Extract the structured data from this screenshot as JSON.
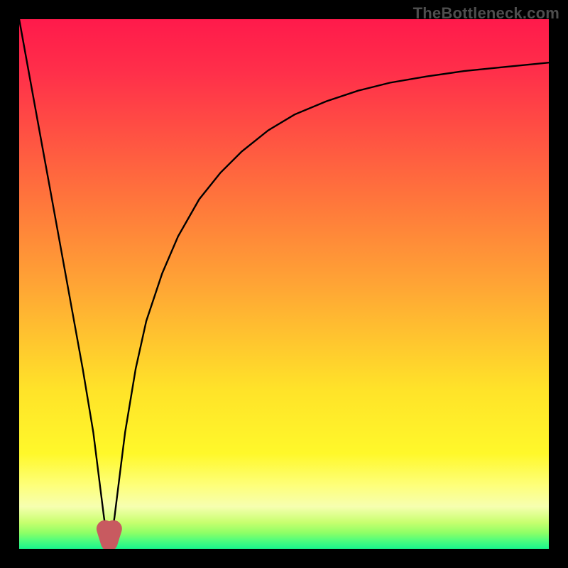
{
  "watermark": "TheBottleneck.com",
  "gradient_colors": {
    "top": "#ff1a4b",
    "red": "#ff2f4a",
    "orange1": "#ff783b",
    "orange2": "#ffa435",
    "yellow": "#ffe329",
    "yellow2": "#fff82a",
    "lightyellow": "#feff7a",
    "paleyellow": "#f6ffb0",
    "lime": "#c8ff6f",
    "green1": "#8eff66",
    "green2": "#4dfd7e",
    "green3": "#19f68c"
  },
  "curve_style": {
    "stroke": "#000000",
    "stroke_width": 2.4
  },
  "marker_style": {
    "fill": "#c85a60",
    "stroke": "#c85a60",
    "stroke_width": 24,
    "radius": 12
  },
  "chart_data": {
    "type": "line",
    "title": "",
    "xlabel": "",
    "ylabel": "",
    "xlim": [
      0,
      100
    ],
    "ylim": [
      0,
      100
    ],
    "x": [
      0,
      2,
      4,
      6,
      8,
      10,
      12,
      14,
      15,
      16,
      16.5,
      17,
      17.5,
      18,
      19,
      20,
      22,
      24,
      27,
      30,
      34,
      38,
      42,
      47,
      52,
      58,
      64,
      70,
      77,
      84,
      92,
      100
    ],
    "values": [
      100,
      89,
      78,
      67,
      56,
      45,
      34,
      22,
      14,
      6,
      2.5,
      1.2,
      2.5,
      6,
      14,
      22,
      34,
      43,
      52,
      59,
      66,
      71,
      75,
      79,
      82,
      84.5,
      86.5,
      88,
      89.2,
      90.2,
      91,
      91.8
    ],
    "marker_points_x": [
      16.2,
      17,
      17.8
    ],
    "marker_points_y": [
      3.8,
      1.2,
      3.8
    ],
    "note": "y is plotted downward from top of plot area; values are percentage of plot height from top."
  }
}
